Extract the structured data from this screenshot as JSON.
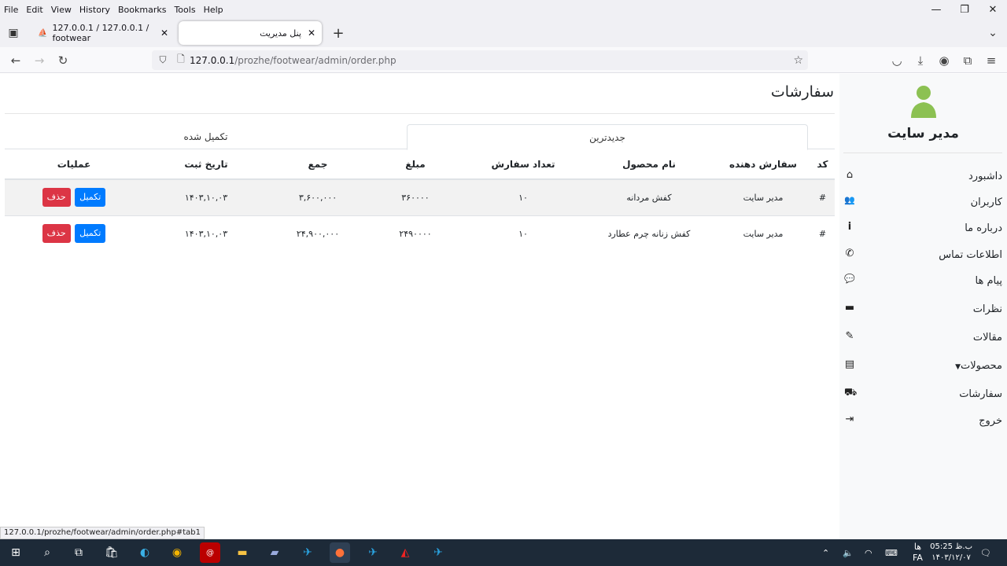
{
  "browser": {
    "menu": [
      "File",
      "Edit",
      "View",
      "History",
      "Bookmarks",
      "Tools",
      "Help"
    ],
    "tabs": [
      {
        "title": "127.0.0.1 / 127.0.0.1 / footwear"
      },
      {
        "title": "پنل مدیریت"
      }
    ],
    "url_host": "127.0.0.1",
    "url_path": "/prozhe/footwear/admin/order.php",
    "status_url": "127.0.0.1/prozhe/footwear/admin/order.php#tab1"
  },
  "sidebar": {
    "admin_name": "مدیر سایت",
    "items": [
      {
        "label": "داشبورد",
        "icon": "home-icon",
        "glyph": "⌂"
      },
      {
        "label": "کاربران",
        "icon": "users-icon",
        "glyph": "👥"
      },
      {
        "label": "درباره ما",
        "icon": "info-icon",
        "glyph": "i"
      },
      {
        "label": "اطلاعات تماس",
        "icon": "phone-icon",
        "glyph": "✆"
      },
      {
        "label": "پیام ها",
        "icon": "comments-icon",
        "glyph": "💬"
      },
      {
        "label": "نظرات",
        "icon": "comment-icon",
        "glyph": "▬"
      },
      {
        "label": "مقالات",
        "icon": "edit-icon",
        "glyph": "✎"
      },
      {
        "label": "محصولات",
        "icon": "box-icon",
        "glyph": "▤"
      },
      {
        "label": "سفارشات",
        "icon": "order-icon",
        "glyph": "⛟"
      },
      {
        "label": "خروج",
        "icon": "logout-icon",
        "glyph": "⇥"
      }
    ]
  },
  "page": {
    "title": "سفارشات",
    "tabs": {
      "newest": "جدیدترین",
      "completed": "تکمیل شده"
    },
    "columns": {
      "code": "کد",
      "customer": "سفارش دهنده",
      "product": "نام محصول",
      "qty": "تعداد سفارش",
      "price": "مبلغ",
      "total": "جمع",
      "date": "تاریخ ثبت",
      "actions": "عملیات"
    },
    "rows": [
      {
        "code": "#",
        "customer": "مدیر سایت",
        "product": "کفش مردانه",
        "qty": "۱۰",
        "price": "۳۶۰۰۰۰",
        "total": "۳,۶۰۰,۰۰۰",
        "date": "۱۴۰۳,۱۰,۰۳"
      },
      {
        "code": "#",
        "customer": "مدیر سایت",
        "product": "کفش زنانه چرم عطارد",
        "qty": "۱۰",
        "price": "۲۴۹۰۰۰۰",
        "total": "۲۴,۹۰۰,۰۰۰",
        "date": "۱۴۰۳,۱۰,۰۳"
      }
    ],
    "buttons": {
      "complete": "تکمیل",
      "delete": "حذف"
    }
  },
  "taskbar": {
    "time": "05:25 ب.ظ",
    "date": "۱۴۰۳/۱۲/۰۷",
    "lang": "FA",
    "lang2": "ها"
  }
}
